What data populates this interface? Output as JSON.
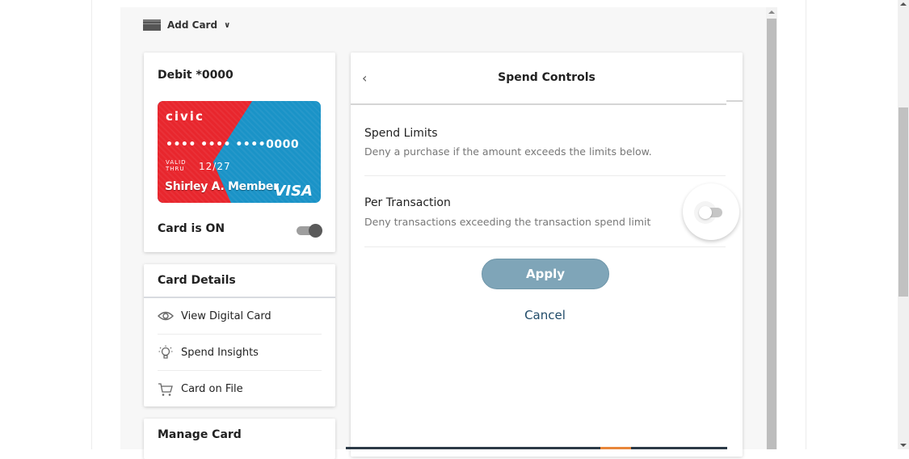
{
  "toolbar": {
    "add_card_label": "Add Card",
    "add_card_icon": "credit-card-icon",
    "dropdown_icon": "chevron-down-icon"
  },
  "card_panel": {
    "title": "Debit *0000",
    "card": {
      "brand": "civic",
      "number": "•••• •••• ••••0000",
      "valid_label": "VALID\nTHRU",
      "expiry": "12/27",
      "holder": "Shirley A. Member",
      "network": "VISA",
      "colors": {
        "red": "#e8262d",
        "blue": "#1a93c7"
      }
    },
    "status_label": "Card is ON",
    "status_on": true
  },
  "card_details": {
    "heading": "Card Details",
    "items": [
      {
        "label": "View Digital Card",
        "icon": "eye-icon"
      },
      {
        "label": "Spend Insights",
        "icon": "lightbulb-icon"
      },
      {
        "label": "Card on File",
        "icon": "cart-icon"
      }
    ]
  },
  "manage_card": {
    "heading": "Manage Card"
  },
  "spend_controls": {
    "back_icon": "chevron-left-icon",
    "title": "Spend Controls",
    "sections": [
      {
        "title": "Spend Limits",
        "description": "Deny a purchase if the amount exceeds the limits below."
      },
      {
        "title": "Per Transaction",
        "description": "Deny transactions exceeding the transaction spend limit",
        "toggle_on": false
      }
    ],
    "apply_label": "Apply",
    "cancel_label": "Cancel",
    "colors": {
      "apply": "#7fa5b8",
      "cancel": "#1f4a68"
    }
  }
}
